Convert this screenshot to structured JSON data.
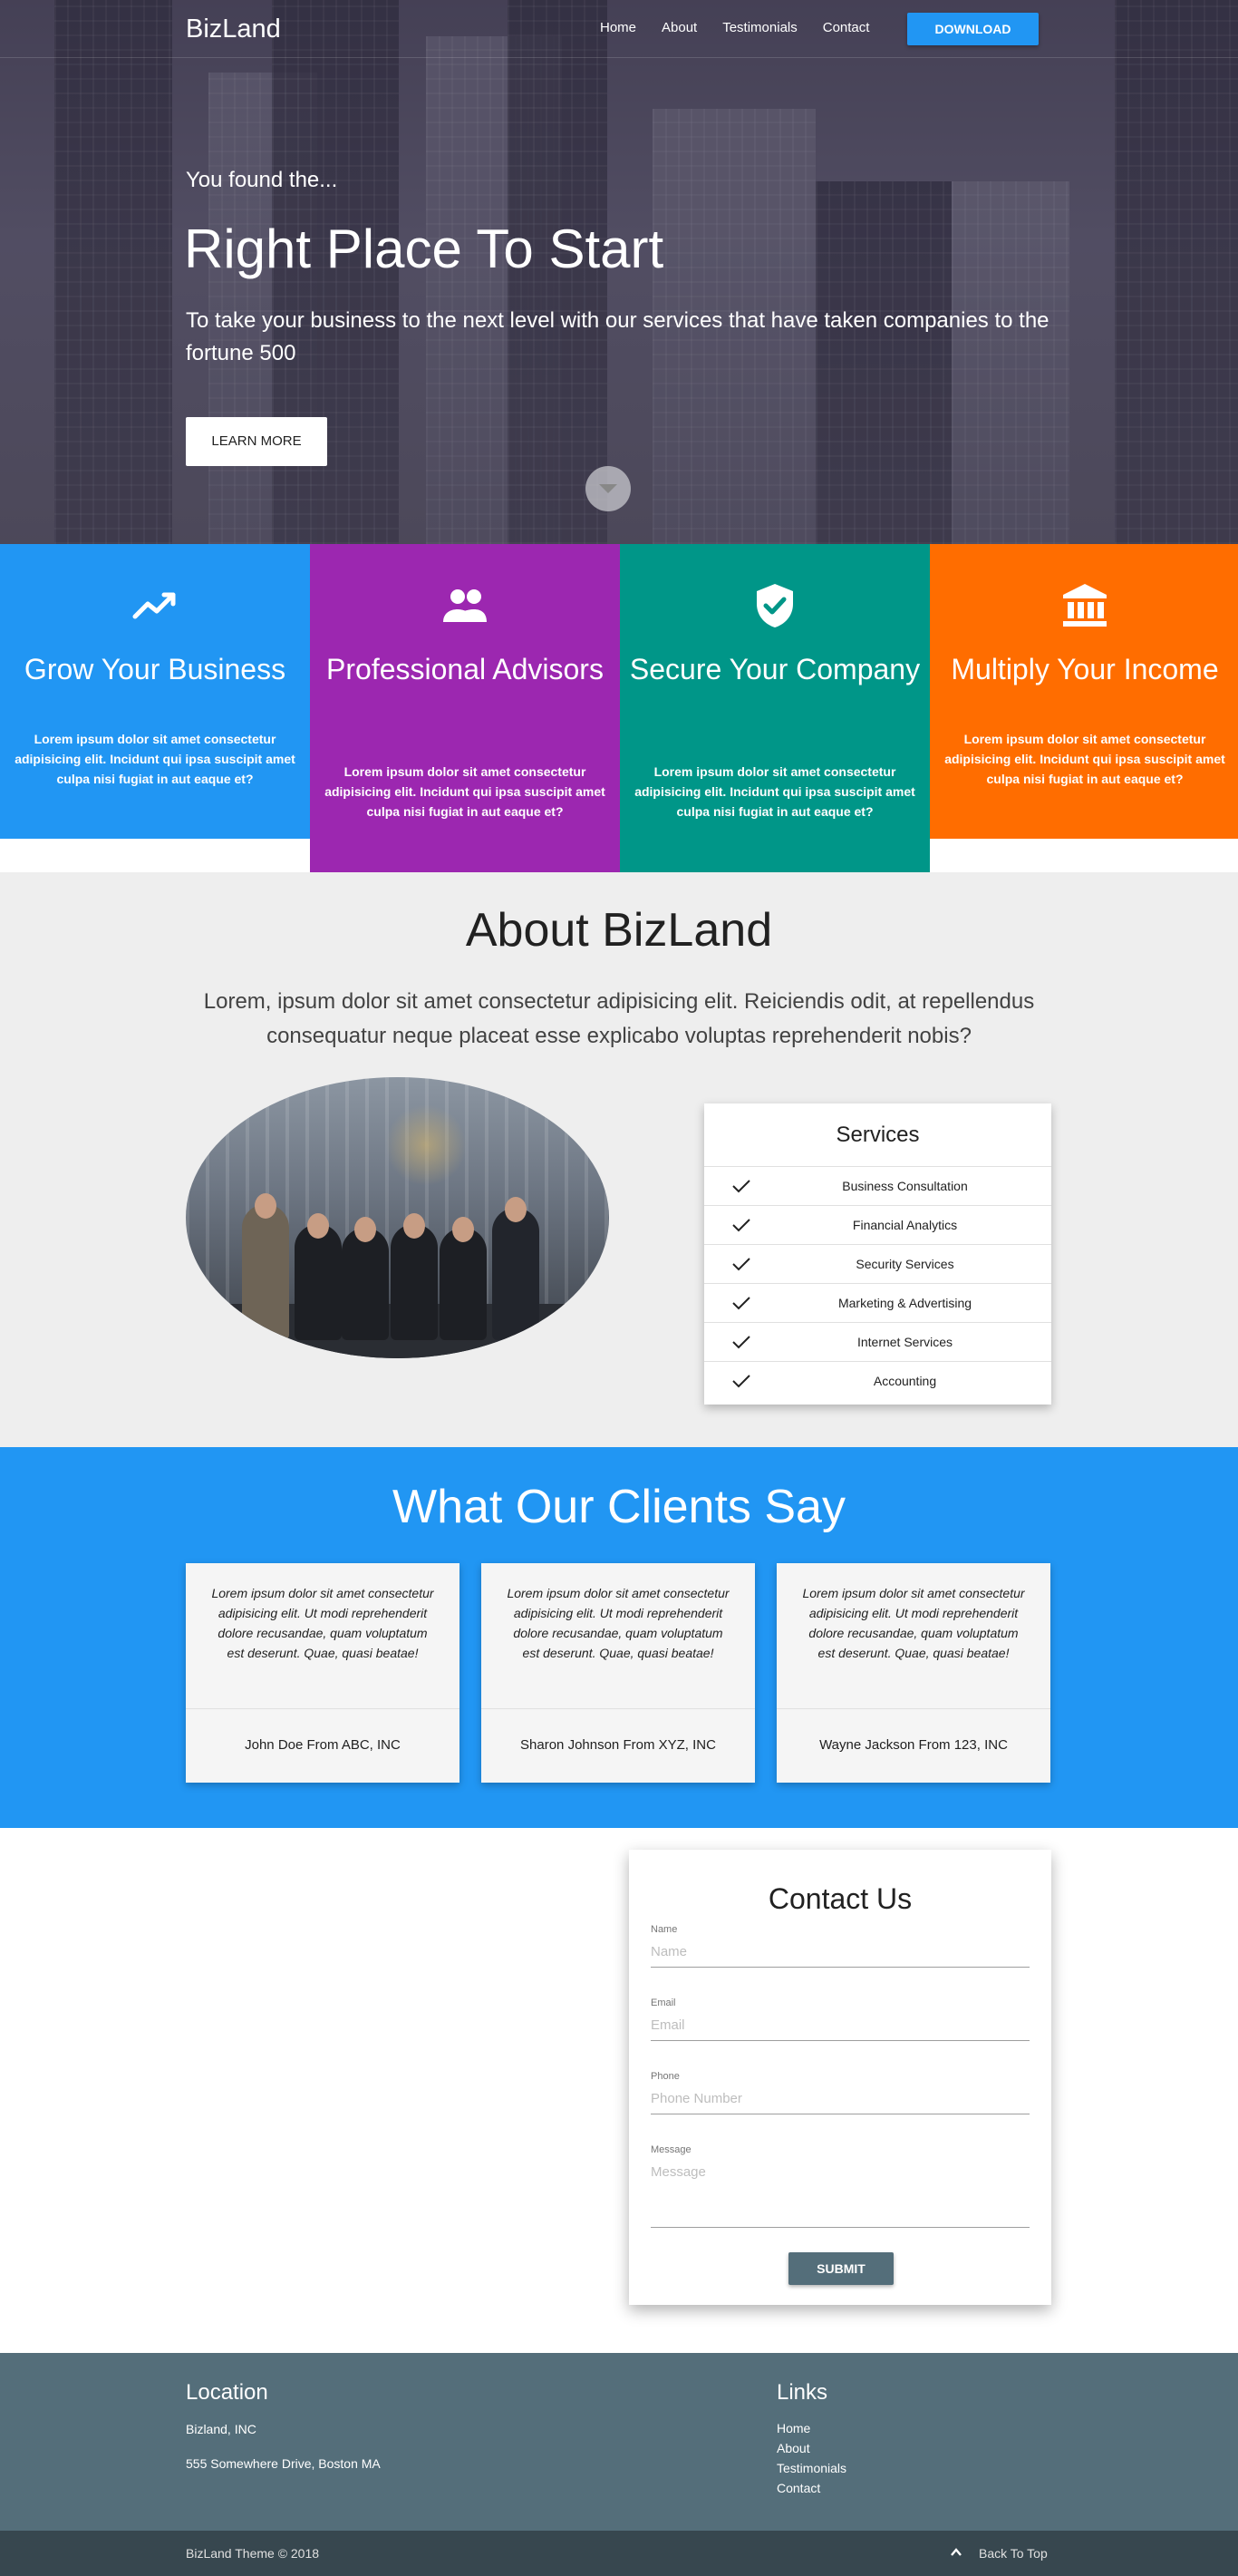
{
  "nav": {
    "brand": "BizLand",
    "links": [
      "Home",
      "About",
      "Testimonials",
      "Contact"
    ],
    "download_label": "DOWNLOAD",
    "accent": "#2196f3"
  },
  "hero": {
    "subtitle": "You found the...",
    "title": "Right Place To Start",
    "text": "To take your business to the next level with our services that have taken companies to the fortune 500",
    "button_label": "LEARN MORE",
    "scroll_icon": "chevron-down-icon"
  },
  "features": [
    {
      "title": "Grow Your Business",
      "text": "Lorem ipsum dolor sit amet consectetur adipisicing elit. Incidunt qui ipsa suscipit amet culpa nisi fugiat in aut eaque et?",
      "color": "#2196f3",
      "icon": "trending-up-icon"
    },
    {
      "title": "Professional Advisors",
      "text": "Lorem ipsum dolor sit amet consectetur adipisicing elit. Incidunt qui ipsa suscipit amet culpa nisi fugiat in aut eaque et?",
      "color": "#9c27b0",
      "icon": "people-icon"
    },
    {
      "title": "Secure Your Company",
      "text": "Lorem ipsum dolor sit amet consectetur adipisicing elit. Incidunt qui ipsa suscipit amet culpa nisi fugiat in aut eaque et?",
      "color": "#009688",
      "icon": "shield-check-icon"
    },
    {
      "title": "Multiply Your Income",
      "text": "Lorem ipsum dolor sit amet consectetur adipisicing elit. Incidunt qui ipsa suscipit amet culpa nisi fugiat in aut eaque et?",
      "color": "#ff6d00",
      "icon": "bank-icon"
    }
  ],
  "about": {
    "title": "About BizLand",
    "lead": "Lorem, ipsum dolor sit amet consectetur adipisicing elit. Reiciendis odit, at repellendus consequatur neque placeat esse explicabo voluptas reprehenderit nobis?",
    "services_title": "Services",
    "services": [
      "Business Consultation",
      "Financial Analytics",
      "Security Services",
      "Marketing & Advertising",
      "Internet Services",
      "Accounting"
    ]
  },
  "testimonials": {
    "title": "What Our Clients Say",
    "items": [
      {
        "quote": "Lorem ipsum dolor sit amet consectetur adipisicing elit. Ut modi reprehenderit dolore recusandae, quam voluptatum est deserunt. Quae, quasi beatae!",
        "author": "John Doe From ABC, INC"
      },
      {
        "quote": "Lorem ipsum dolor sit amet consectetur adipisicing elit. Ut modi reprehenderit dolore recusandae, quam voluptatum est deserunt. Quae, quasi beatae!",
        "author": "Sharon Johnson From XYZ, INC"
      },
      {
        "quote": "Lorem ipsum dolor sit amet consectetur adipisicing elit. Ut modi reprehenderit dolore recusandae, quam voluptatum est deserunt. Quae, quasi beatae!",
        "author": "Wayne Jackson From 123, INC"
      }
    ]
  },
  "contact": {
    "title": "Contact Us",
    "fields": [
      {
        "label": "Name",
        "placeholder": "Name"
      },
      {
        "label": "Email",
        "placeholder": "Email"
      },
      {
        "label": "Phone",
        "placeholder": "Phone Number"
      },
      {
        "label": "Message",
        "placeholder": "Message"
      }
    ],
    "submit_label": "SUBMIT"
  },
  "footer": {
    "location_title": "Location",
    "company": "Bizland, INC",
    "address": "555 Somewhere Drive, Boston MA",
    "links_title": "Links",
    "links": [
      "Home",
      "About",
      "Testimonials",
      "Contact"
    ],
    "copyright": "BizLand Theme © 2018",
    "back_to_top": "Back To Top",
    "color": "#546e7a",
    "bar_color": "#37474f"
  }
}
